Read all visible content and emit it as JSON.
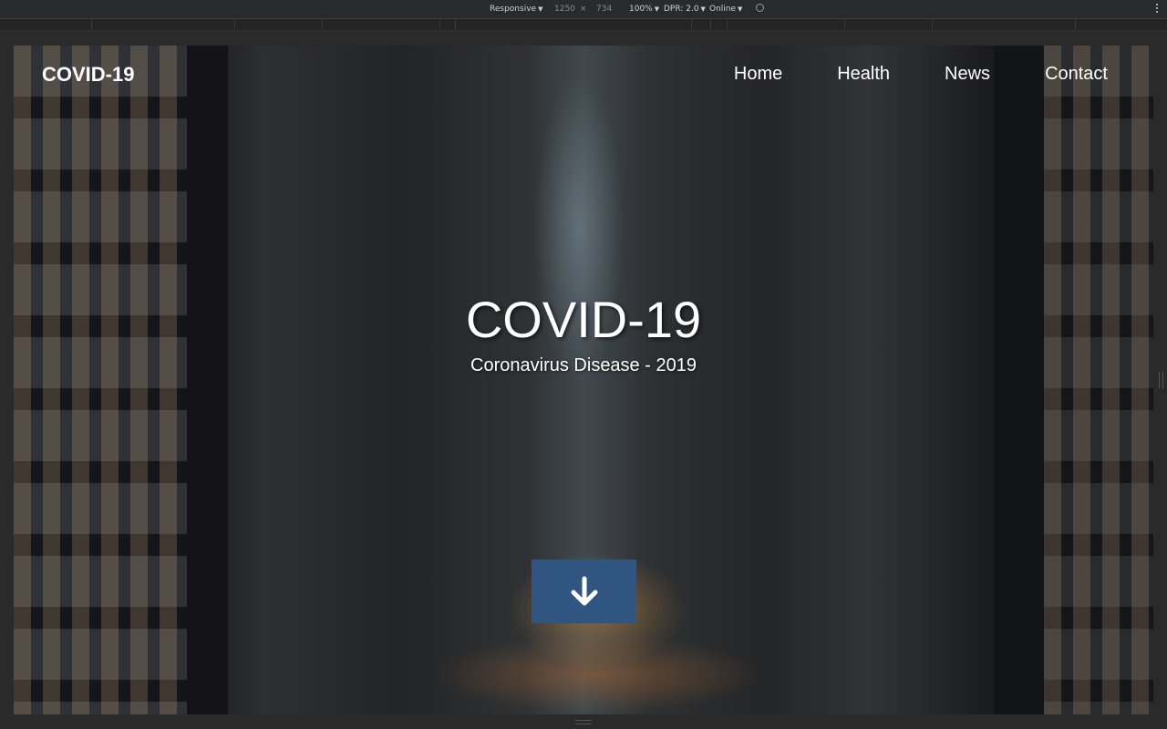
{
  "devtools": {
    "device": "Responsive",
    "width": "1250",
    "times": "×",
    "height": "734",
    "zoom": "100%",
    "dpr": "DPR: 2.0",
    "network": "Online",
    "caret": "▼"
  },
  "nav": {
    "brand": "COVID-19",
    "links": [
      "Home",
      "Health",
      "News",
      "Contact"
    ]
  },
  "hero": {
    "title": "COVID-19",
    "subtitle": "Coronavirus Disease - 2019"
  },
  "colors": {
    "button": "#2f5580",
    "text": "#ffffff"
  }
}
